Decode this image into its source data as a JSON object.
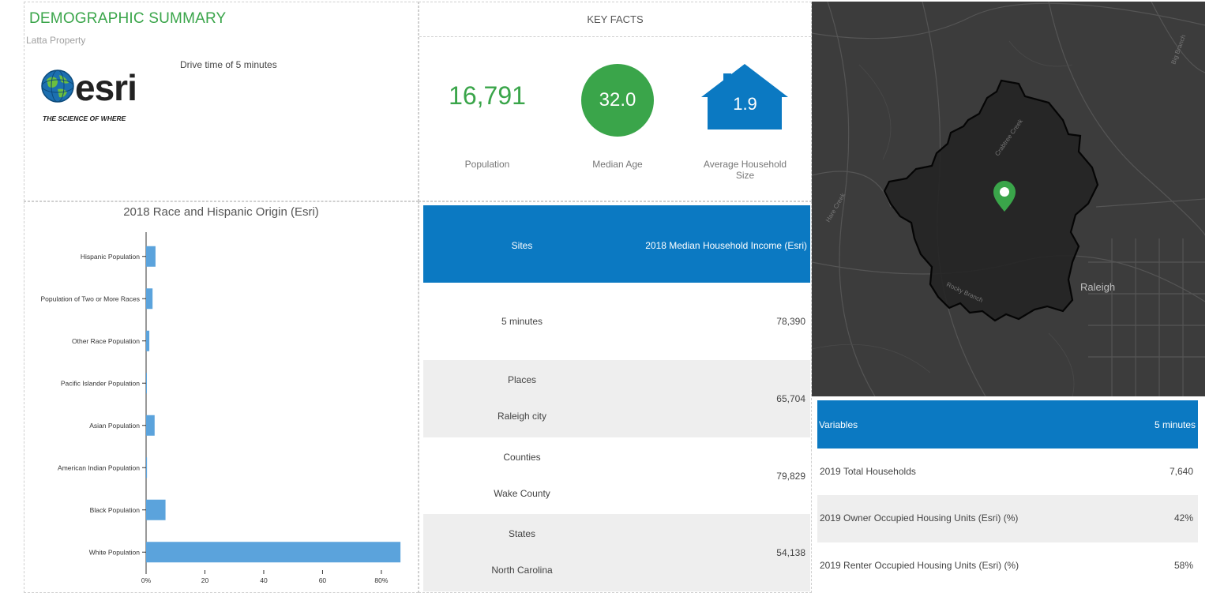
{
  "summary": {
    "title": "DEMOGRAPHIC SUMMARY",
    "subtitle": "Latta Property",
    "drive_time": "Drive time of 5 minutes",
    "logo": {
      "wordmark": "esri",
      "tagline": "THE SCIENCE OF WHERE",
      "icon": "globe-icon"
    }
  },
  "key_facts": {
    "header": "KEY FACTS",
    "population_value": "16,791",
    "population_label": "Population",
    "median_age_value": "32.0",
    "median_age_label": "Median Age",
    "household_size_value": "1.9",
    "household_size_label_1": "Average Household",
    "household_size_label_2": "Size",
    "accent_color": "#3aa54a",
    "blue_color": "#0b79c2"
  },
  "chart_data": {
    "type": "bar",
    "orientation": "horizontal",
    "title": "2018 Race and Hispanic Origin (Esri)",
    "categories": [
      "Hispanic Population",
      "Population of Two or More Races",
      "Other Race Population",
      "Pacific Islander Population",
      "Asian Population",
      "American Indian Population",
      "Black Population",
      "White Population"
    ],
    "values": [
      3.2,
      2.2,
      1.1,
      0.2,
      2.9,
      0.3,
      6.6,
      86.5
    ],
    "xlim": [
      0,
      87
    ],
    "xticks": [
      0,
      20,
      40,
      60,
      80
    ],
    "xtick_labels": [
      "0%",
      "20",
      "40",
      "60",
      "80%"
    ],
    "bar_color": "#5ba3dc",
    "grid": false
  },
  "income_table": {
    "header_sites": "Sites",
    "header_income": "2018 Median Household Income (Esri)",
    "rows": [
      {
        "category": "",
        "name": "5 minutes",
        "value": "78,390"
      },
      {
        "category": "Places",
        "name": "Raleigh city",
        "value": "65,704"
      },
      {
        "category": "Counties",
        "name": "Wake County",
        "value": "79,829"
      },
      {
        "category": "States",
        "name": "North Carolina",
        "value": "54,138"
      }
    ]
  },
  "map": {
    "label": "Raleigh",
    "marker_icon": "location-pin-icon",
    "road_labels": [
      "Hare Creek",
      "Crabtree Creek",
      "Rocky Branch",
      "Big Branch"
    ]
  },
  "variables_table": {
    "header_left": "Variables",
    "header_right": "5 minutes",
    "rows": [
      {
        "name": "2019 Total Households",
        "value": "7,640"
      },
      {
        "name": "2019 Owner Occupied Housing Units (Esri) (%)",
        "value": "42%"
      },
      {
        "name": "2019 Renter Occupied Housing Units (Esri) (%)",
        "value": "58%"
      }
    ]
  }
}
